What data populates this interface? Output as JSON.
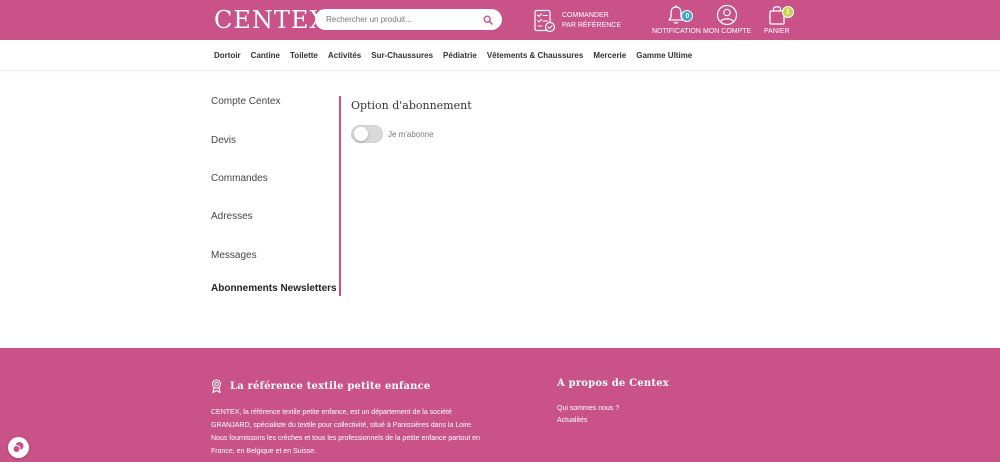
{
  "colors": {
    "brand": "#c95389",
    "badge_notification": "#3fa3c7",
    "badge_cart": "#c7d44a",
    "toggle_off": "#d9d9d9"
  },
  "header": {
    "logo_text": "CENTEX",
    "search": {
      "placeholder": "Rechercher un produit...",
      "value": "",
      "icon": "search-icon"
    },
    "order_by_ref": {
      "label": "Commander par référence",
      "icon": "checklist-icon"
    },
    "notification": {
      "label": "Notification",
      "count": "0",
      "icon": "bell-icon"
    },
    "account": {
      "label": "Mon compte",
      "icon": "user-icon"
    },
    "cart": {
      "label": "Panier",
      "count": "1",
      "icon": "shopping-bag-icon"
    }
  },
  "nav": {
    "items": [
      "Dortoir",
      "Cantine",
      "Toilette",
      "Activités",
      "Sur-Chaussures",
      "Pédiatrie",
      "Vêtements & Chaussures",
      "Mercerie",
      "Gamme Ultime"
    ]
  },
  "sidebar": {
    "items": [
      {
        "label": "Compte Centex",
        "active": false
      },
      {
        "label": "Devis",
        "active": false
      },
      {
        "label": "Commandes",
        "active": false
      },
      {
        "label": "Adresses",
        "active": false
      },
      {
        "label": "Messages",
        "active": false
      },
      {
        "label": "Abonnements Newsletters",
        "active": true
      }
    ]
  },
  "content": {
    "title": "Option d'abonnement",
    "subscribe_toggle": {
      "label": "Je m'abonne",
      "checked": false
    }
  },
  "footer": {
    "col1": {
      "title": "La référence textile petite enfance",
      "icon": "award-ribbon-icon",
      "text": "CENTEX, la référence textile petite enfance, est un département de la société GRANJARD, spécialiste du textile pour collectivité, situé à Panissières dans la Loire. Nous fournissons les crèches et tous les professionnels de la petite enfance partout en France, en Belgique et en Suisse."
    },
    "col2": {
      "title": "A propos de Centex",
      "links": [
        "Qui sommes nous ?",
        "Actualités"
      ]
    }
  },
  "chat_button": {
    "icon": "chat-bubble-icon"
  }
}
